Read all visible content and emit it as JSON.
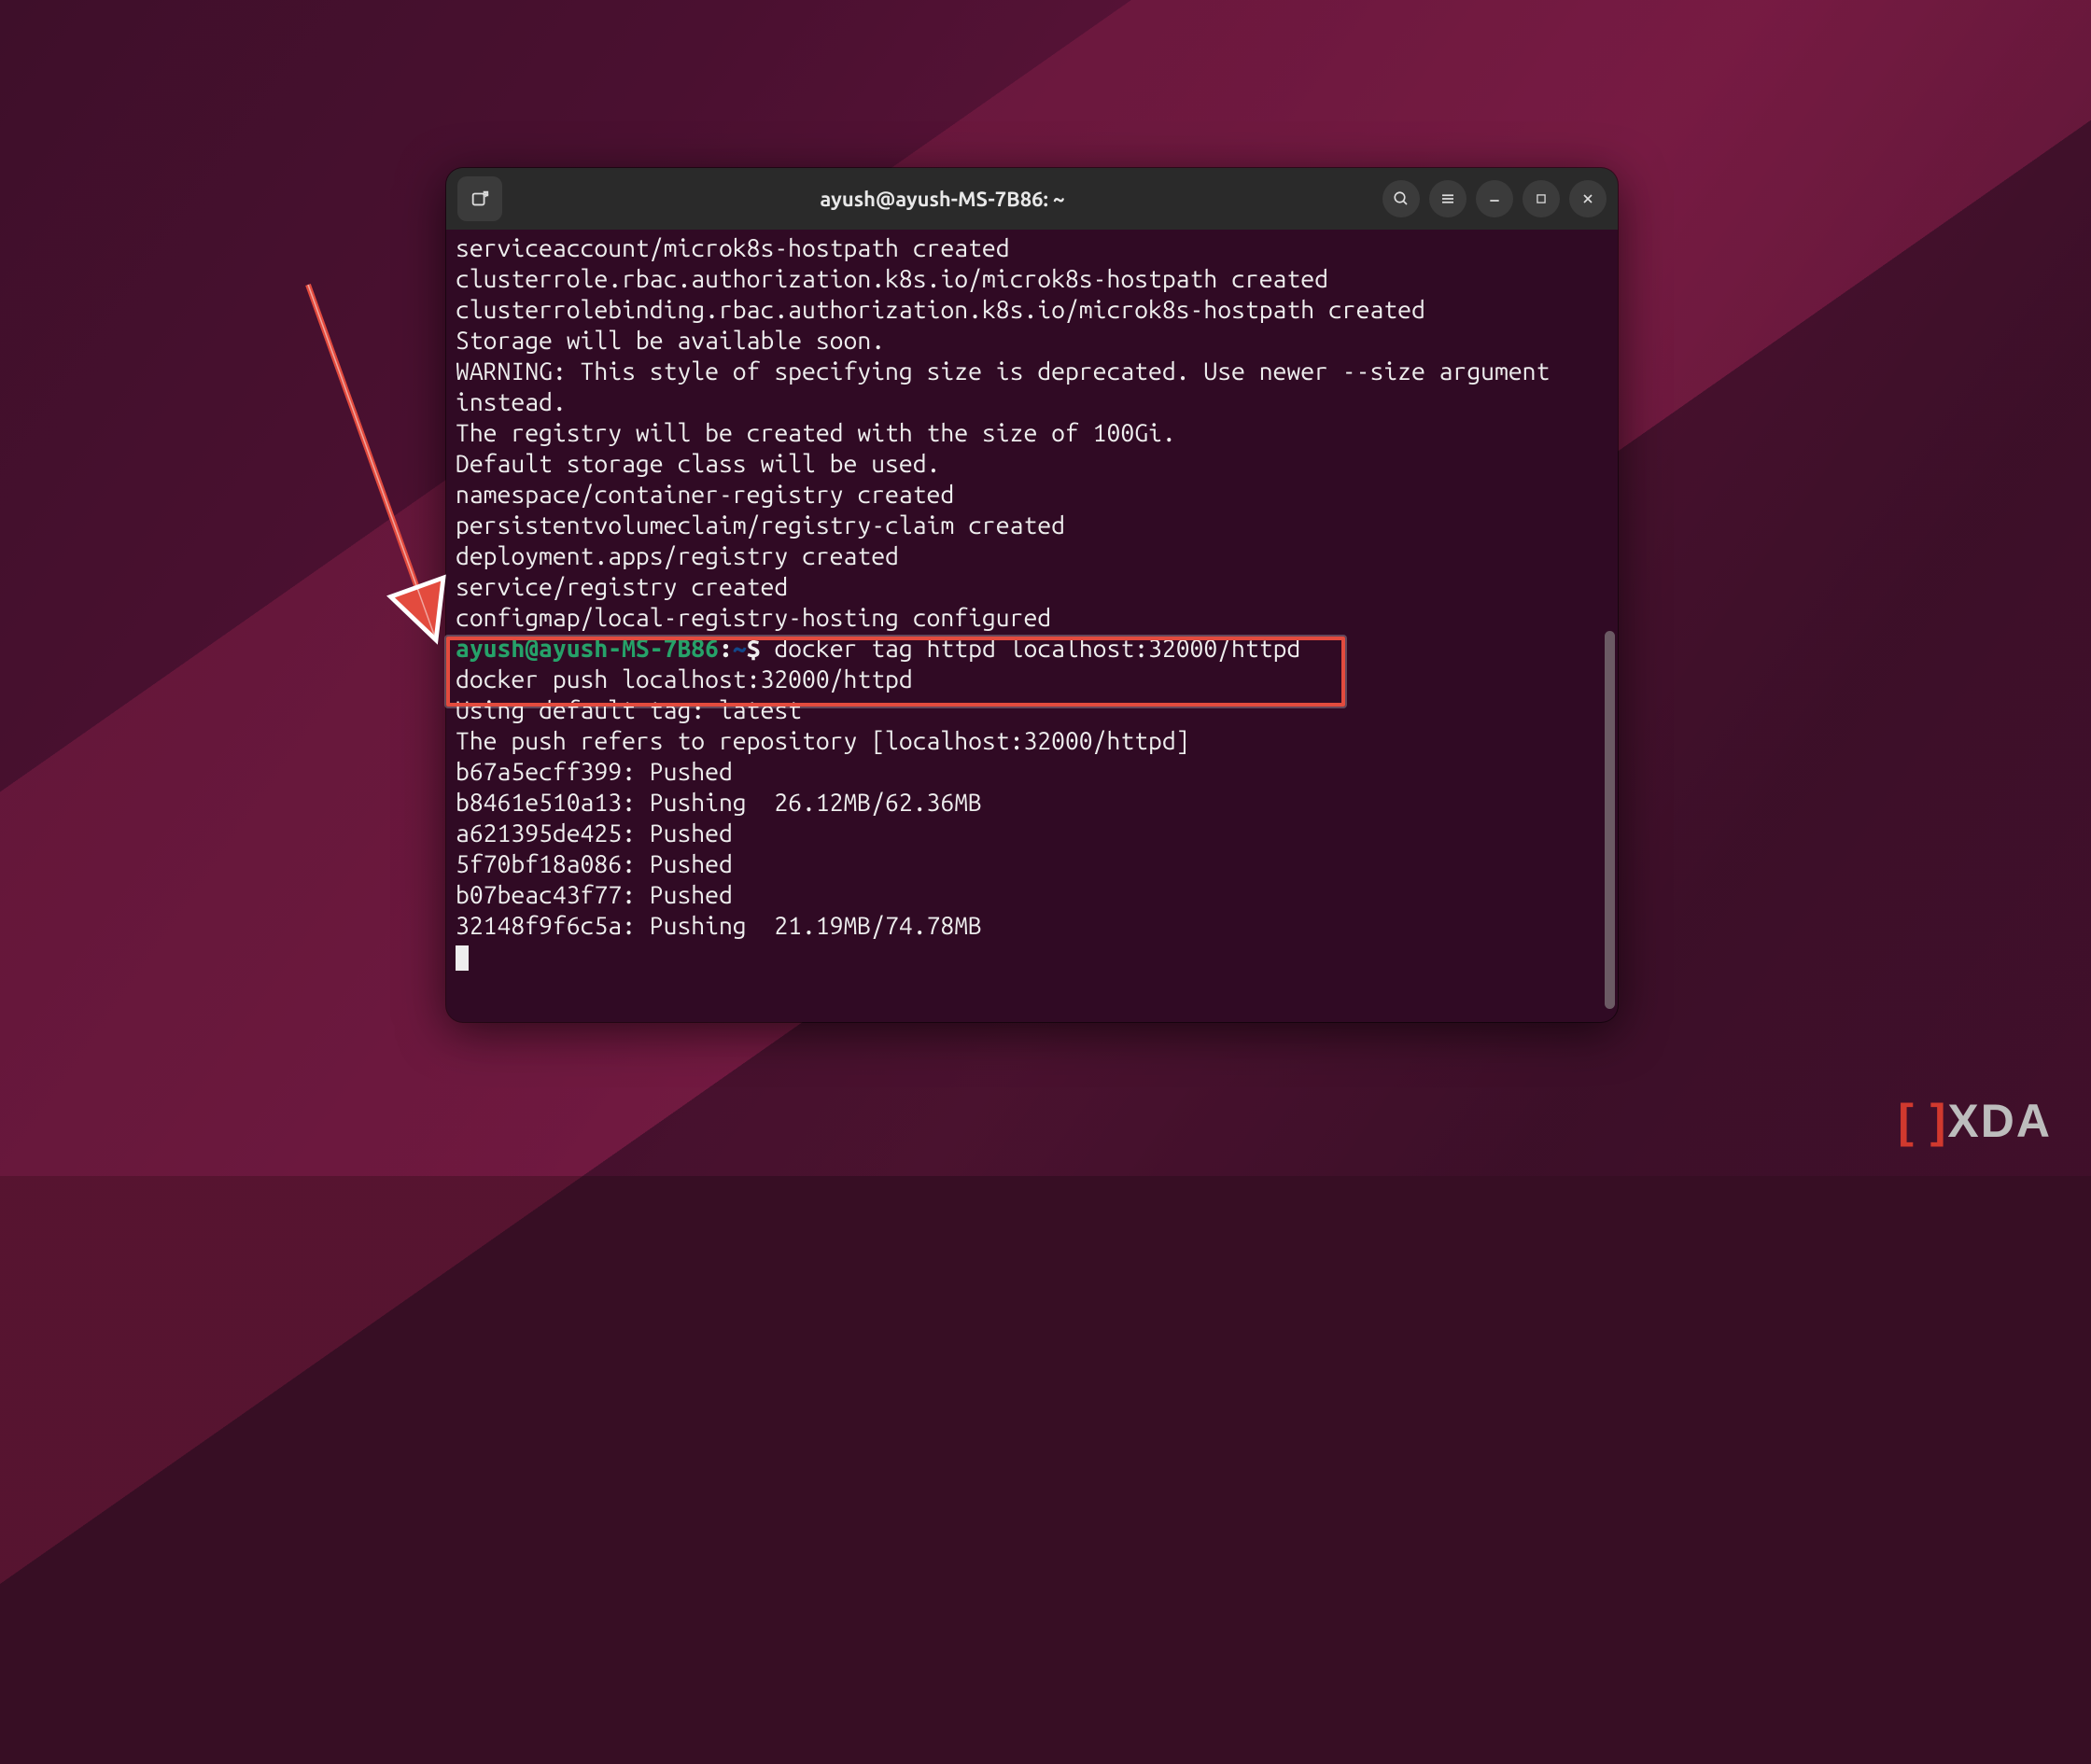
{
  "window": {
    "title": "ayush@ayush-MS-7B86: ~"
  },
  "prompt": {
    "user": "ayush@ayush-MS-7B86",
    "sep": ":",
    "path": "~",
    "symbol": "$"
  },
  "lines": {
    "l0": "serviceaccount/microk8s-hostpath created",
    "l1": "clusterrole.rbac.authorization.k8s.io/microk8s-hostpath created",
    "l2": "clusterrolebinding.rbac.authorization.k8s.io/microk8s-hostpath created",
    "l3": "Storage will be available soon.",
    "l4": "WARNING: This style of specifying size is deprecated. Use newer --size argument ",
    "l5": "instead.",
    "l6": "The registry will be created with the size of 100Gi.",
    "l7": "Default storage class will be used.",
    "l8": "namespace/container-registry created",
    "l9": "persistentvolumeclaim/registry-claim created",
    "l10": "deployment.apps/registry created",
    "l11": "service/registry created",
    "l12": "configmap/local-registry-hosting configured",
    "cmd1": " docker tag httpd localhost:32000/httpd",
    "cmd2": "docker push localhost:32000/httpd",
    "l13": "Using default tag: latest",
    "l14": "The push refers to repository [localhost:32000/httpd]",
    "l15": "b67a5ecff399: Pushed",
    "l16": "b8461e510a13: Pushing  26.12MB/62.36MB",
    "l17": "a621395de425: Pushed",
    "l18": "5f70bf18a086: Pushed",
    "l19": "b07beac43f77: Pushed",
    "l20": "32148f9f6c5a: Pushing  21.19MB/74.78MB"
  },
  "logo": {
    "text": "XDA"
  }
}
